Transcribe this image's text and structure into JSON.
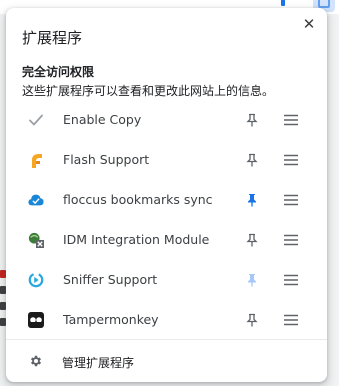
{
  "header": {
    "title": "扩展程序",
    "close_symbol": "✕"
  },
  "access": {
    "title": "完全访问权限",
    "description": "这些扩展程序可以查看和更改此网站上的信息。"
  },
  "extensions": [
    {
      "name": "Enable Copy",
      "icon": "checkmark-icon",
      "pinned": false
    },
    {
      "name": "Flash Support",
      "icon": "flash-icon",
      "pinned": false
    },
    {
      "name": "floccus bookmarks sync",
      "icon": "cloud-check-icon",
      "pinned": true
    },
    {
      "name": "IDM Integration Module",
      "icon": "idm-icon",
      "pinned": false
    },
    {
      "name": "Sniffer Support",
      "icon": "sniffer-icon",
      "pinned": true
    },
    {
      "name": "Tampermonkey",
      "icon": "tampermonkey-icon",
      "pinned": false
    }
  ],
  "footer": {
    "manage_label": "管理扩展程序",
    "icon": "gear-icon"
  },
  "colors": {
    "pin_active": "#1a73e8",
    "pin_inactive": "#5f6368",
    "pin_faded": "#a8c7fa"
  }
}
